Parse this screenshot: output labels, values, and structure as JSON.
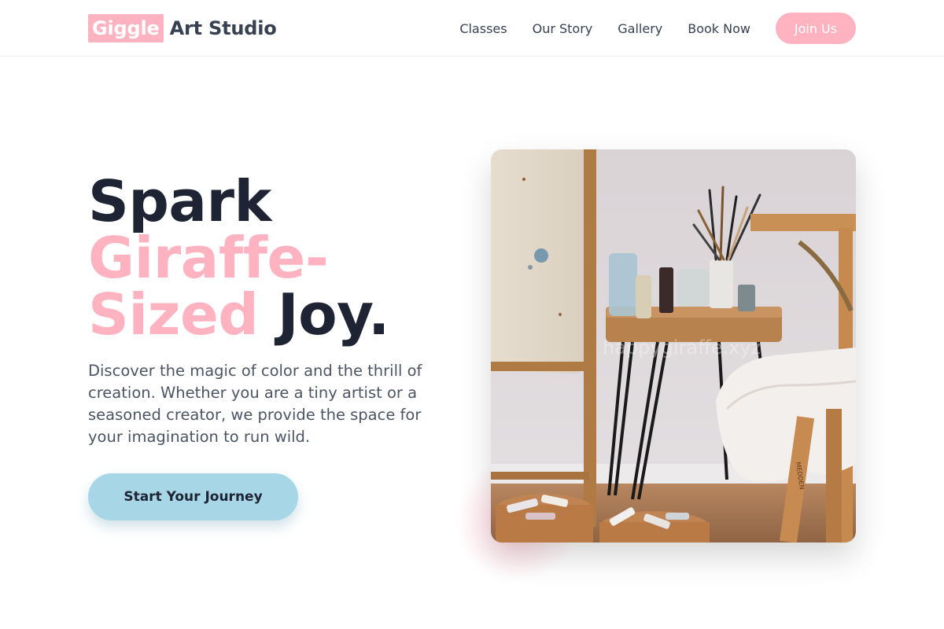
{
  "header": {
    "logo_highlight": "Giggle",
    "logo_rest": "Art Studio",
    "nav": [
      "Classes",
      "Our Story",
      "Gallery",
      "Book Now"
    ],
    "join_label": "Join Us"
  },
  "hero": {
    "title_word1": "Spark",
    "title_pink1": "Giraffe-",
    "title_pink2": "Sized",
    "title_word2": "Joy.",
    "description": "Discover the magic of color and the thrill of creation. Whether you are a tiny artist or a seasoned creator, we provide the space for your imagination to run wild.",
    "cta_label": "Start Your Journey"
  },
  "image": {
    "watermark": "happygiraffe.xyz",
    "stool_text": "MEDDEN"
  },
  "colors": {
    "accent_pink": "#ffb3c1",
    "accent_blue": "#a7d7e7",
    "text_dark": "#1e2433",
    "text_muted": "#4b5563"
  }
}
